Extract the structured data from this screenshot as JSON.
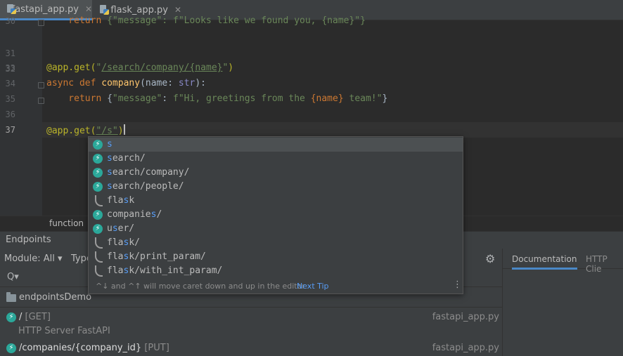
{
  "tabs": [
    {
      "label": "fastapi_app.py",
      "close": "✕",
      "active": true
    },
    {
      "label": "flask_app.py",
      "close": "✕",
      "active": false
    }
  ],
  "line_numbers": [
    "30",
    "31",
    "32",
    "33",
    "34",
    "35",
    "36",
    "37"
  ],
  "code": {
    "line30_pre": "    return ",
    "line30_str": "{\"message\": f\"Looks like we found you, {name}\"}",
    "line33_dec": "@app.get(",
    "line33_str_open": "\"",
    "line33_path": "/search/company/{name}",
    "line33_str_close": "\"",
    "line33_end": ")",
    "line34_kw": "async def ",
    "line34_fn": "company",
    "line34_args_pre": "(name: ",
    "line34_type": "str",
    "line34_args_post": "):",
    "line35_kw": "    return ",
    "line35_open": "{",
    "line35_key": "\"message\"",
    "line35_colon": ": ",
    "line35_f": "f\"Hi, greetings from the ",
    "line35_var": "{name}",
    "line35_rest": " team!\"",
    "line35_close": "}",
    "line37_dec": "@app.get(",
    "line37_str": "\"/s\"",
    "line37_end": ")"
  },
  "breadcrumb": "function",
  "completion": {
    "items": [
      {
        "icon": "bolt",
        "match": "s",
        "rest": ""
      },
      {
        "icon": "bolt",
        "match": "s",
        "rest": "earch/"
      },
      {
        "icon": "bolt",
        "match": "s",
        "rest": "earch/company/"
      },
      {
        "icon": "bolt",
        "match": "s",
        "rest": "earch/people/"
      },
      {
        "icon": "flask",
        "pre": "fla",
        "match": "s",
        "rest": "k"
      },
      {
        "icon": "bolt",
        "pre": "companie",
        "match": "s",
        "rest": "/"
      },
      {
        "icon": "bolt",
        "pre": "u",
        "match": "s",
        "rest": "er/"
      },
      {
        "icon": "flask",
        "pre": "fla",
        "match": "s",
        "rest": "k/"
      },
      {
        "icon": "flask",
        "pre": "fla",
        "match": "s",
        "rest": "k/print_param/"
      },
      {
        "icon": "flask",
        "pre": "fla",
        "match": "s",
        "rest": "k/with_int_param/"
      }
    ],
    "hint_text": "^↓ and ^↑ will move caret down and up in the editor",
    "next_tip": "Next Tip"
  },
  "endpoints_panel": {
    "title": "Endpoints",
    "module_filter": "Module: All ▾",
    "type_filter": "Type",
    "search_placeholder": "Q▾",
    "group": "endpointsDemo",
    "rows": [
      {
        "path": "/",
        "method": "[GET]",
        "file": "fastapi_app.py",
        "sub": "HTTP Server   FastAPI"
      },
      {
        "path": "/companies/{company_id}",
        "method": "[PUT]",
        "file": "fastapi_app.py"
      }
    ]
  },
  "right_panel": {
    "tabs": [
      "Documentation",
      "HTTP Clie"
    ]
  },
  "colors": {
    "bolt": "#2ba89a",
    "selection": "#4c5052",
    "match": "#589df6",
    "tab_underline": "#4a88c7"
  }
}
